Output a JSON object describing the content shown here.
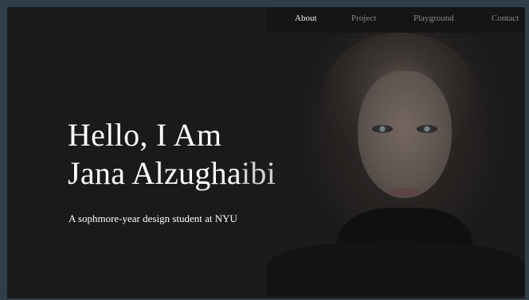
{
  "nav": {
    "items": [
      {
        "label": "About",
        "active": true
      },
      {
        "label": "Project",
        "active": false
      },
      {
        "label": "Playground",
        "active": false
      },
      {
        "label": "Contact",
        "active": false
      }
    ]
  },
  "hero": {
    "line1": "Hello, I Am",
    "line2_main": "Jana Alzugha",
    "line2_end": "ibi",
    "subtitle": "A sophmore-year design student at NYU"
  },
  "colors": {
    "page_border": "#2f3e48",
    "background": "#1a1a1a",
    "nav_bar": "#151515",
    "nav_active": "#f2f2f2",
    "nav_inactive": "#8a8a8a",
    "text": "#ffffff"
  }
}
